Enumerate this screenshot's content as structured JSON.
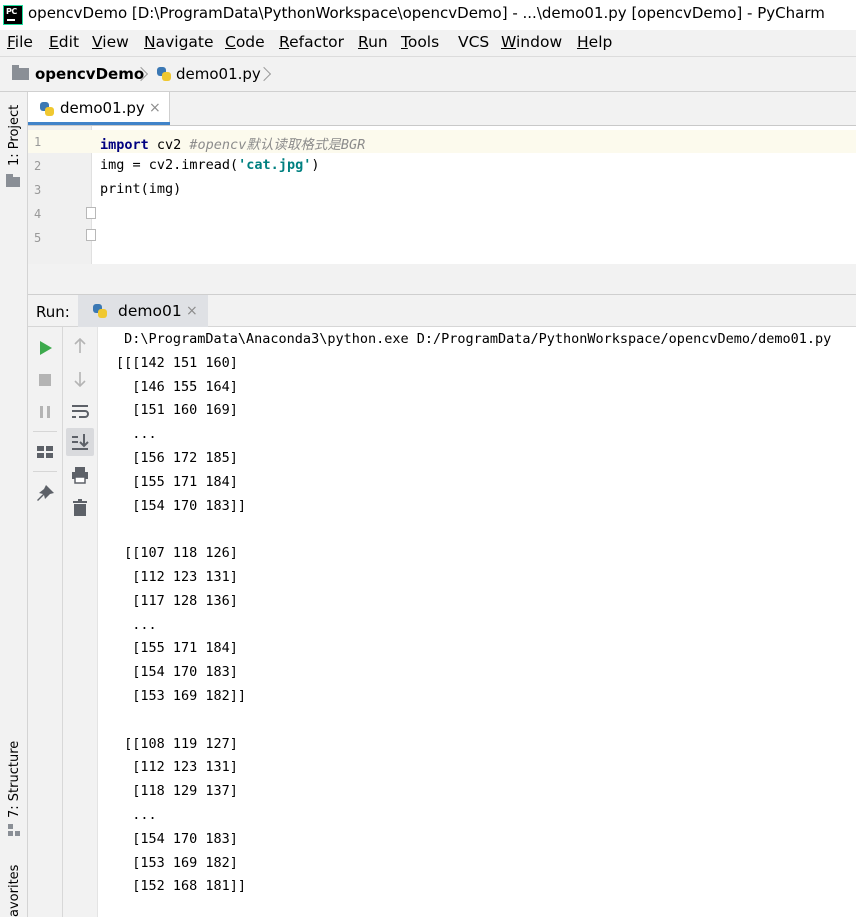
{
  "window": {
    "title": "opencvDemo [D:\\ProgramData\\PythonWorkspace\\opencvDemo] - ...\\demo01.py [opencvDemo] - PyCharm",
    "logo_text": "PC"
  },
  "menu": [
    {
      "mnemonic": "F",
      "rest": "ile"
    },
    {
      "mnemonic": "E",
      "rest": "dit"
    },
    {
      "mnemonic": "V",
      "rest": "iew"
    },
    {
      "mnemonic": "N",
      "rest": "avigate"
    },
    {
      "mnemonic": "C",
      "rest": "ode"
    },
    {
      "mnemonic": "R",
      "rest": "efactor"
    },
    {
      "mnemonic": "R",
      "rest": "un",
      "pre": ""
    },
    {
      "mnemonic": "T",
      "rest": "ools"
    },
    {
      "mnemonic": "",
      "rest": "VCS"
    },
    {
      "mnemonic": "W",
      "rest": "indow"
    },
    {
      "mnemonic": "H",
      "rest": "elp"
    }
  ],
  "breadcrumb": {
    "project": "opencvDemo",
    "file": "demo01.py"
  },
  "side_panels": {
    "project": "1: Project",
    "structure": "7: Structure",
    "favorites": "avorites"
  },
  "editor": {
    "tab_label": "demo01.py",
    "line_numbers": [
      "1",
      "2",
      "3",
      "4",
      "5"
    ],
    "code": {
      "l1_kw": "import",
      "l1_mod": " cv2 ",
      "l1_comment": "#opencv默认读取格式是BGR",
      "l2_pre": "img = cv2.imread(",
      "l2_str": "'cat.jpg'",
      "l2_post": ")",
      "l3": "print(img)"
    }
  },
  "run_panel": {
    "label": "Run:",
    "tab_label": "demo01",
    "console_lines": [
      " D:\\ProgramData\\Anaconda3\\python.exe D:/ProgramData/PythonWorkspace/opencvDemo/demo01.py",
      "[[[142 151 160]",
      "  [146 155 164]",
      "  [151 160 169]",
      "  ...",
      "  [156 172 185]",
      "  [155 171 184]",
      "  [154 170 183]]",
      "",
      " [[107 118 126]",
      "  [112 123 131]",
      "  [117 128 136]",
      "  ...",
      "  [155 171 184]",
      "  [154 170 183]",
      "  [153 169 182]]",
      "",
      " [[108 119 127]",
      "  [112 123 131]",
      "  [118 129 137]",
      "  ...",
      "  [154 170 183]",
      "  [153 169 182]",
      "  [152 168 181]]"
    ]
  },
  "colors": {
    "keyword": "#000080",
    "string": "#008080",
    "comment": "#8c8c8c",
    "run_green": "#3daa4d",
    "tab_accent": "#4083c9"
  }
}
